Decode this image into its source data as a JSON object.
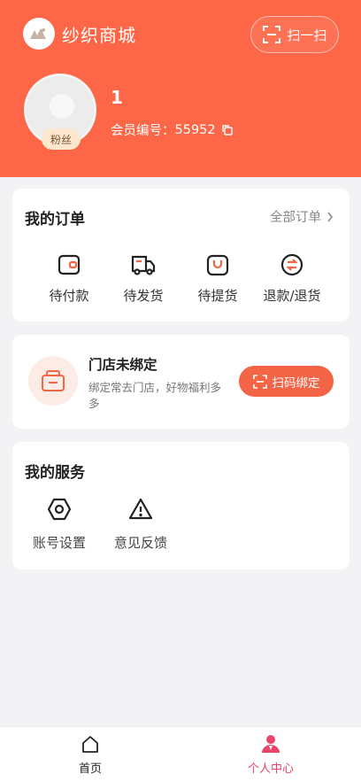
{
  "header": {
    "app_title": "纱织商城",
    "scan_label": "扫一扫",
    "username": "1",
    "member_label": "会员编号：",
    "member_id": "55952",
    "fans_badge": "粉丝"
  },
  "orders": {
    "title": "我的订单",
    "all_label": "全部订单",
    "items": [
      {
        "label": "待付款",
        "icon": "wallet-icon"
      },
      {
        "label": "待发货",
        "icon": "truck-icon"
      },
      {
        "label": "待提货",
        "icon": "bag-icon"
      },
      {
        "label": "退款/退货",
        "icon": "refund-icon"
      }
    ]
  },
  "store": {
    "title": "门店未绑定",
    "desc": "绑定常去门店，好物福利多多",
    "bind_label": "扫码绑定"
  },
  "services": {
    "title": "我的服务",
    "items": [
      {
        "label": "账号设置",
        "icon": "settings-icon"
      },
      {
        "label": "意见反馈",
        "icon": "warning-icon"
      }
    ]
  },
  "tabbar": {
    "home": "首页",
    "profile": "个人中心"
  },
  "colors": {
    "header_bg": "#fd6646",
    "accent": "#f36546",
    "active_tab": "#e8456a"
  }
}
